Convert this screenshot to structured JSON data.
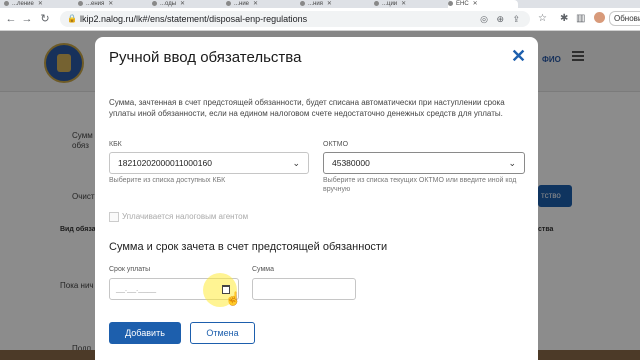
{
  "browser": {
    "tabs": [
      {
        "label": "...ление"
      },
      {
        "label": "...ения"
      },
      {
        "label": "...оды"
      },
      {
        "label": "...ние"
      },
      {
        "label": "...ния"
      },
      {
        "label": "...ции"
      },
      {
        "label": "ЕНС"
      }
    ],
    "url": "lkip2.nalog.ru/lk#/ens/statement/disposal-enp-regulations",
    "signout_label": "Обновить"
  },
  "page": {
    "header_user": "ФИО",
    "bg_card_line1": "Сумм",
    "bg_card_line2": "обяз",
    "bg_clear": "Очист",
    "bg_btn": "тство",
    "bg_col_left": "Вид обяза",
    "bg_col_right": "ства",
    "bg_row": "Пока нич",
    "bg_bottom": "Подп"
  },
  "modal": {
    "title": "Ручной ввод обязательства",
    "description": "Сумма, зачтенная в счет предстоящей обязанности, будет списана автоматически при наступлении срока уплаты иной обязанности, если на едином налоговом счете недостаточно денежных средств для уплаты.",
    "kbk": {
      "label": "КБК",
      "value": "18210202000011000160",
      "hint": "Выберите из списка доступных КБК"
    },
    "oktmo": {
      "label": "ОКТМО",
      "value": "45380000",
      "hint": "Выберите из списка текущих ОКТМО или введите иной код вручную"
    },
    "agent_checkbox_label": "Уплачивается налоговым агентом",
    "section_title": "Сумма и срок зачета в счет предстоящей обязанности",
    "due_date": {
      "label": "Срок уплаты",
      "placeholder": "__.__.____"
    },
    "amount": {
      "label": "Сумма"
    },
    "add_button": "Добавить",
    "cancel_button": "Отмена"
  }
}
